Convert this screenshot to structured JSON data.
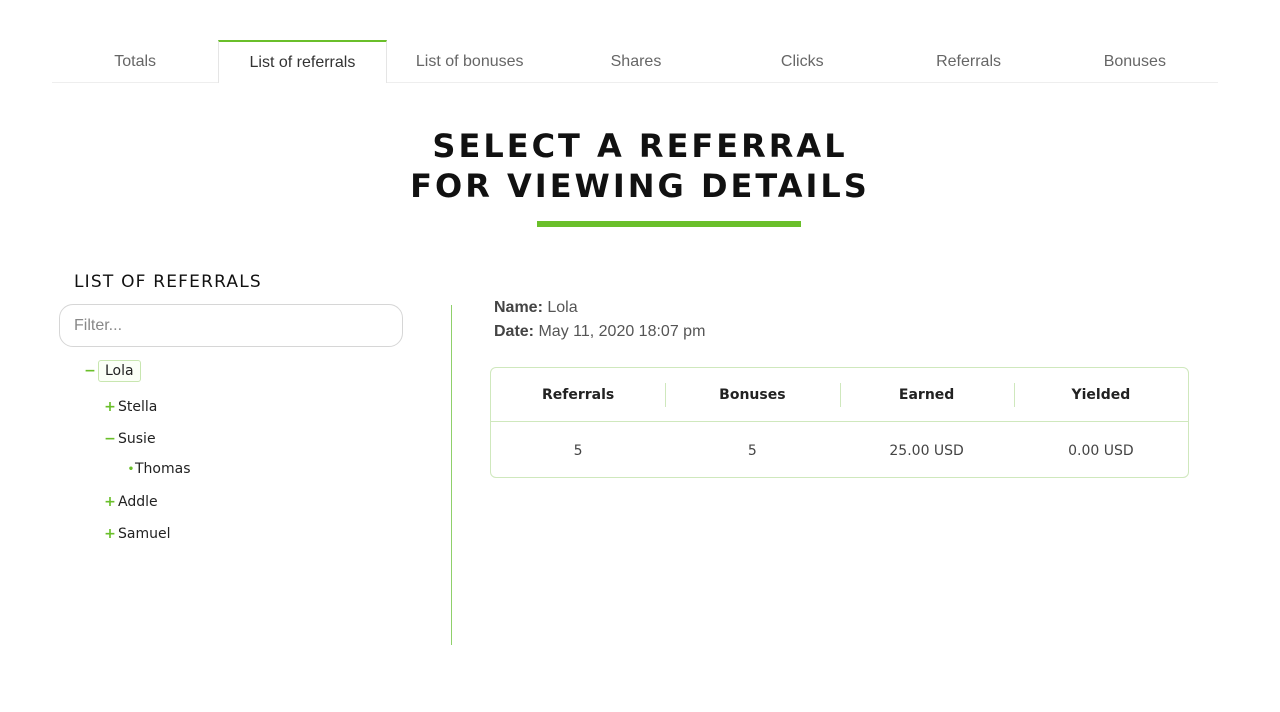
{
  "tabs": [
    {
      "label": "Totals",
      "active": false
    },
    {
      "label": "List of referrals",
      "active": true
    },
    {
      "label": "List of bonuses",
      "active": false
    },
    {
      "label": "Shares",
      "active": false
    },
    {
      "label": "Clicks",
      "active": false
    },
    {
      "label": "Referrals",
      "active": false
    },
    {
      "label": "Bonuses",
      "active": false
    }
  ],
  "title": {
    "line1": "SELECT A REFERRAL",
    "line2": "FOR VIEWING DETAILS"
  },
  "accent_color": "#6abf2a",
  "referrals_panel": {
    "heading": "LIST OF REFERRALS",
    "filter_placeholder": "Filter...",
    "tree": [
      {
        "label": "Lola",
        "toggle": "−",
        "selected": true
      },
      {
        "label": "Stella",
        "toggle": "+"
      },
      {
        "label": "Susie",
        "toggle": "−"
      },
      {
        "label": "Thomas",
        "toggle": "•"
      },
      {
        "label": "Addle",
        "toggle": "+"
      },
      {
        "label": "Samuel",
        "toggle": "+"
      }
    ]
  },
  "details": {
    "name_label": "Name:",
    "name_value": "Lola",
    "date_label": "Date:",
    "date_value": "May 11, 2020 18:07 pm",
    "table": {
      "headers": [
        "Referrals",
        "Bonuses",
        "Earned",
        "Yielded"
      ],
      "values": [
        "5",
        "5",
        "25.00 USD",
        "0.00 USD"
      ]
    }
  }
}
